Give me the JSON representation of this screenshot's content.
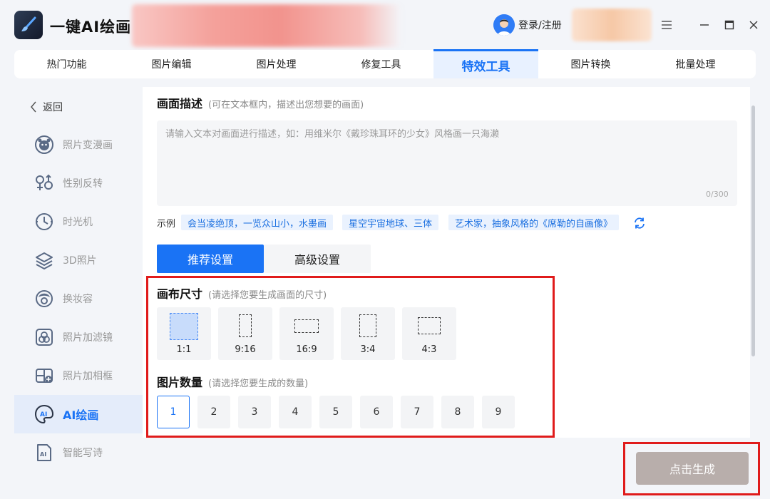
{
  "app": {
    "title": "一键AI绘画"
  },
  "header": {
    "login_label": "登录/注册"
  },
  "topnav": {
    "tabs": [
      {
        "label": "热门功能"
      },
      {
        "label": "图片编辑"
      },
      {
        "label": "图片处理"
      },
      {
        "label": "修复工具"
      },
      {
        "label": "特效工具"
      },
      {
        "label": "图片转换"
      },
      {
        "label": "批量处理"
      }
    ],
    "active_index": 4
  },
  "sidebar": {
    "back_label": "返回",
    "items": [
      {
        "label": "照片变漫画",
        "icon": "cartoon-face-icon"
      },
      {
        "label": "性别反转",
        "icon": "gender-icon"
      },
      {
        "label": "时光机",
        "icon": "clock-icon"
      },
      {
        "label": "3D照片",
        "icon": "layers-icon"
      },
      {
        "label": "换妆容",
        "icon": "makeup-icon"
      },
      {
        "label": "照片加滤镜",
        "icon": "filter-icon"
      },
      {
        "label": "照片加相框",
        "icon": "frame-icon"
      },
      {
        "label": "AI绘画",
        "icon": "ai-paint-icon"
      },
      {
        "label": "智能写诗",
        "icon": "ai-doc-icon"
      }
    ],
    "active_index": 7
  },
  "description": {
    "title": "画面描述",
    "hint": "(可在文本框内，描述出您想要的画面)",
    "placeholder": "请输入文本对画面进行描述，如：用维米尔《戴珍珠耳环的少女》风格画一只海濑",
    "value": "",
    "counter": "0/300",
    "examples_label": "示例",
    "examples": [
      "会当凌绝顶，一览众山小，水墨画",
      "星空宇宙地球、三体",
      "艺术家，抽象风格的《席勒的自画像》"
    ]
  },
  "settings_tabs": {
    "recommended": "推荐设置",
    "advanced": "高级设置"
  },
  "canvas_size": {
    "title": "画布尺寸",
    "hint": "(请选择您要生成画面的尺寸)",
    "options": [
      "1:1",
      "9:16",
      "16:9",
      "3:4",
      "4:3"
    ],
    "selected": "1:1"
  },
  "image_count": {
    "title": "图片数量",
    "hint": "(请选择您要生成的数量)",
    "options": [
      "1",
      "2",
      "3",
      "4",
      "5",
      "6",
      "7",
      "8",
      "9"
    ],
    "selected": "1"
  },
  "generate_button": "点击生成",
  "colors": {
    "accent": "#1a73f5",
    "highlight_red": "#e01b1b",
    "generate_button": "#b8aeab"
  }
}
